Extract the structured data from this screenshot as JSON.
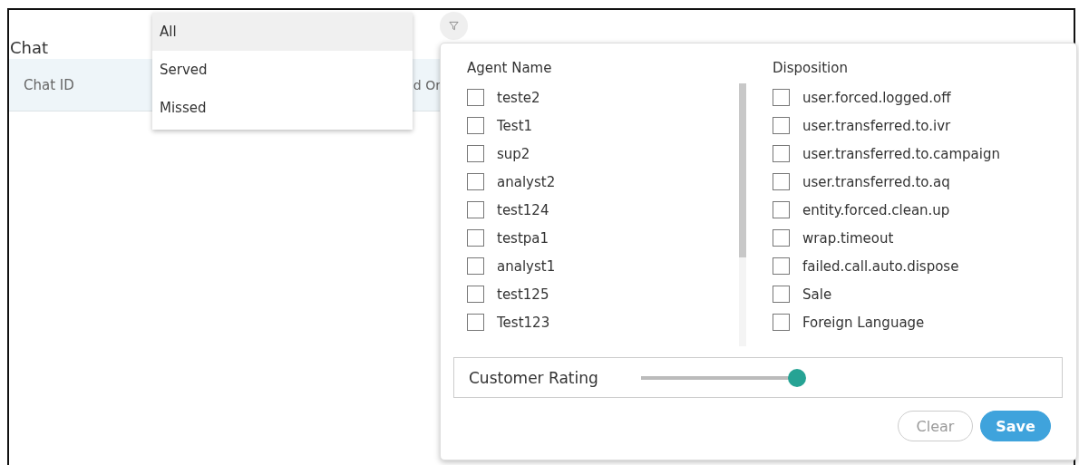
{
  "page": {
    "title": "Chat"
  },
  "table": {
    "columns": [
      "Chat ID",
      "d Or"
    ]
  },
  "dropdown": {
    "options": [
      {
        "label": "All",
        "selected": true
      },
      {
        "label": "Served",
        "selected": false
      },
      {
        "label": "Missed",
        "selected": false
      }
    ]
  },
  "filter_panel": {
    "agent_name": {
      "heading": "Agent Name",
      "items": [
        {
          "label": "teste2",
          "checked": false
        },
        {
          "label": "Test1",
          "checked": false
        },
        {
          "label": "sup2",
          "checked": false
        },
        {
          "label": "analyst2",
          "checked": false
        },
        {
          "label": "test124",
          "checked": false
        },
        {
          "label": "testpa1",
          "checked": false
        },
        {
          "label": "analyst1",
          "checked": false
        },
        {
          "label": "test125",
          "checked": false
        },
        {
          "label": "Test123",
          "checked": false
        }
      ]
    },
    "disposition": {
      "heading": "Disposition",
      "items": [
        {
          "label": "user.forced.logged.off",
          "checked": false
        },
        {
          "label": "user.transferred.to.ivr",
          "checked": false
        },
        {
          "label": "user.transferred.to.campaign",
          "checked": false
        },
        {
          "label": "user.transferred.to.aq",
          "checked": false
        },
        {
          "label": "entity.forced.clean.up",
          "checked": false
        },
        {
          "label": "wrap.timeout",
          "checked": false
        },
        {
          "label": "failed.call.auto.dispose",
          "checked": false
        },
        {
          "label": "Sale",
          "checked": false
        },
        {
          "label": "Foreign Language",
          "checked": false
        }
      ]
    },
    "customer_rating": {
      "label": "Customer Rating",
      "level": 1.0
    },
    "buttons": [
      {
        "label": "Clear",
        "kind": "secondary"
      },
      {
        "label": "Save",
        "kind": "primary"
      }
    ]
  }
}
